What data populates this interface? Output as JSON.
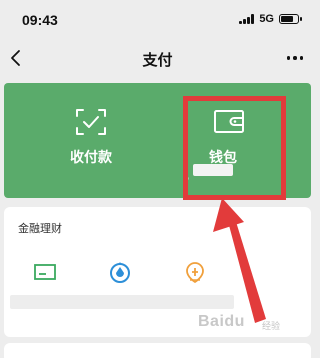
{
  "status_bar": {
    "time": "09:43",
    "network": "5G"
  },
  "nav": {
    "title": "支付",
    "back_icon": "chevron-left-icon",
    "more_icon": "more-dots-icon"
  },
  "pay_card": {
    "background": "#5aab6b",
    "items": [
      {
        "label": "收付款",
        "icon": "scan-check-icon"
      },
      {
        "label": "钱包",
        "icon": "wallet-icon"
      }
    ]
  },
  "annotation": {
    "highlight_color": "#e23b3b",
    "arrow_color": "#e23b3b"
  },
  "finance": {
    "title": "金融理财",
    "icons": [
      "card-icon",
      "fund-icon",
      "insurance-icon"
    ]
  },
  "watermark": {
    "text": "Baidu",
    "sub": "经验"
  }
}
